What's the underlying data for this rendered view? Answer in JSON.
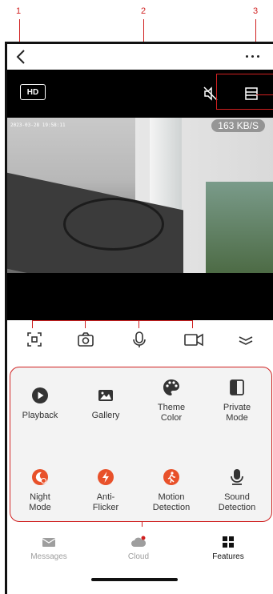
{
  "annotations": [
    "1",
    "2",
    "3"
  ],
  "video": {
    "hd_label": "HD",
    "timestamp": "2023-03-28 19:58:11",
    "speed": "163 KB/S"
  },
  "toolbar": {
    "icons": [
      "fullscreen-icon",
      "snapshot-icon",
      "microphone-icon",
      "record-icon",
      "collapse-icon"
    ]
  },
  "features": [
    {
      "label": "Playback",
      "icon": "play-icon"
    },
    {
      "label": "Gallery",
      "icon": "image-icon"
    },
    {
      "label": "Theme\nColor",
      "icon": "palette-icon"
    },
    {
      "label": "Private\nMode",
      "icon": "privacy-icon"
    },
    {
      "label": "Night\nMode",
      "icon": "night-mode-icon"
    },
    {
      "label": "Anti-\nFlicker",
      "icon": "lightning-icon"
    },
    {
      "label": "Motion\nDetection",
      "icon": "motion-icon"
    },
    {
      "label": "Sound\nDetection",
      "icon": "microphone-icon"
    }
  ],
  "tabs": [
    {
      "label": "Messages",
      "color": "#9e9e9e"
    },
    {
      "label": "Cloud",
      "color": "#9e9e9e"
    },
    {
      "label": "Features",
      "color": "#111111"
    }
  ],
  "colors": {
    "accent": "#e8512a",
    "annotation": "#d02020",
    "icon": "#333333"
  }
}
